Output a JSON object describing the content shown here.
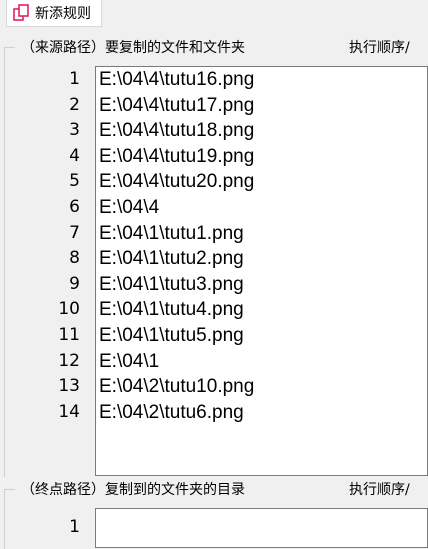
{
  "tab": {
    "label": "新添规则"
  },
  "source": {
    "title": "（来源路径）要复制的文件和文件夹",
    "right_label": "执行顺序/",
    "line_numbers": [
      "1",
      "2",
      "3",
      "4",
      "5",
      "6",
      "7",
      "8",
      "9",
      "10",
      "11",
      "12",
      "13",
      "14"
    ],
    "lines": [
      "E:\\04\\4\\tutu16.png",
      "E:\\04\\4\\tutu17.png",
      "E:\\04\\4\\tutu18.png",
      "E:\\04\\4\\tutu19.png",
      "E:\\04\\4\\tutu20.png",
      "E:\\04\\4",
      "E:\\04\\1\\tutu1.png",
      "E:\\04\\1\\tutu2.png",
      "E:\\04\\1\\tutu3.png",
      "E:\\04\\1\\tutu4.png",
      "E:\\04\\1\\tutu5.png",
      "E:\\04\\1",
      "E:\\04\\2\\tutu10.png",
      "E:\\04\\2\\tutu6.png"
    ]
  },
  "destination": {
    "title": "（终点路径）复制到的文件夹的目录",
    "right_label": "执行顺序/",
    "line_numbers": [
      "1"
    ],
    "lines": [
      ""
    ]
  },
  "colors": {
    "accent_icon": "#e0245e"
  }
}
